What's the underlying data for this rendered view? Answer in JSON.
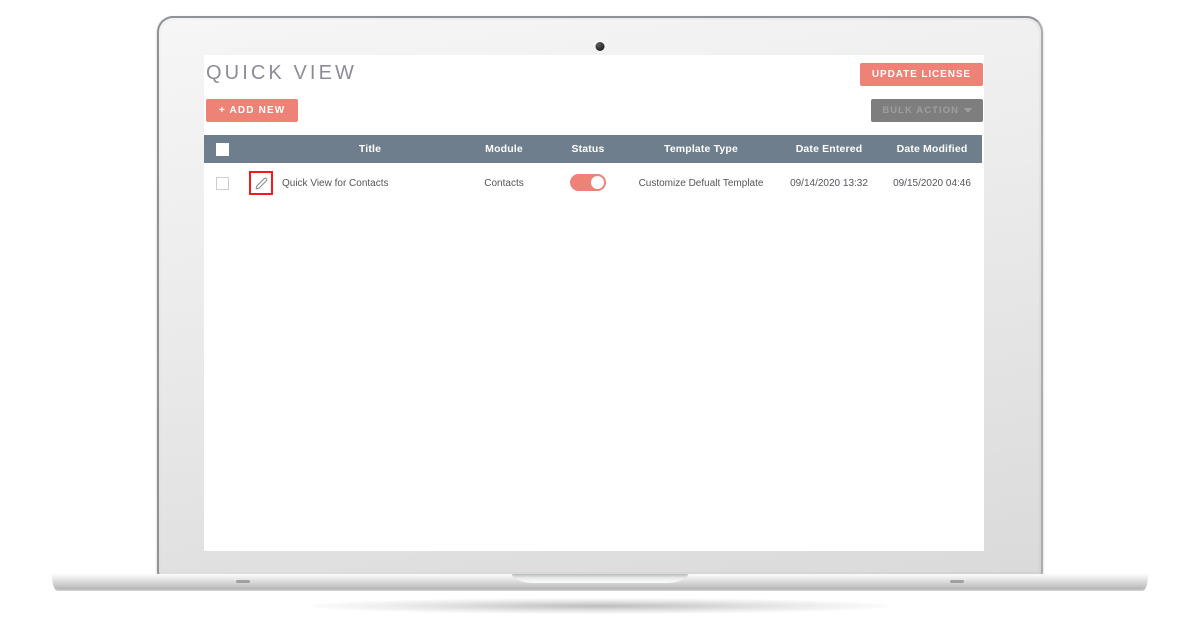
{
  "device": {
    "type": "laptop-mockup",
    "camera_icon": "camera-dot-icon"
  },
  "app": {
    "page_title": "QUICK VIEW",
    "buttons": {
      "add_new": "+ ADD NEW",
      "update_license": "UPDATE LICENSE",
      "bulk_action": "BULK ACTION",
      "bulk_action_caret_icon": "chevron-down-icon"
    },
    "colors": {
      "accent": "#ee8277",
      "table_header": "#6f7e8c",
      "bulk_action_bg": "#7e7e7e",
      "title_text": "#8c8c99",
      "highlight_box": "#f41a1a"
    },
    "table": {
      "columns": [
        {
          "key": "select",
          "label": ""
        },
        {
          "key": "edit",
          "label": ""
        },
        {
          "key": "title",
          "label": "Title"
        },
        {
          "key": "module",
          "label": "Module"
        },
        {
          "key": "status",
          "label": "Status"
        },
        {
          "key": "type",
          "label": "Template Type"
        },
        {
          "key": "entered",
          "label": "Date Entered"
        },
        {
          "key": "modified",
          "label": "Date Modified"
        }
      ],
      "select_all_icon": "checkbox-icon",
      "rows": [
        {
          "select_icon": "checkbox-icon",
          "edit_icon": "pencil-icon",
          "edit_highlighted": true,
          "title": "Quick View for Contacts",
          "module": "Contacts",
          "status_on": true,
          "status_icon": "toggle-on-icon",
          "type": "Customize Defualt Template",
          "entered": "09/14/2020 13:32",
          "modified": "09/15/2020 04:46"
        }
      ]
    }
  }
}
